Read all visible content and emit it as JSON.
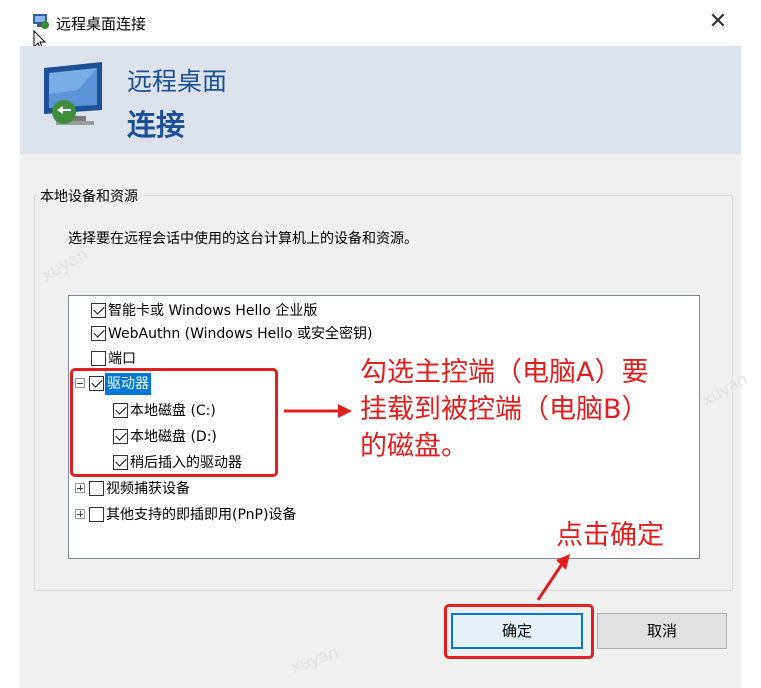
{
  "window": {
    "title": "远程桌面连接",
    "close_glyph": "✕"
  },
  "banner": {
    "line1": "远程桌面",
    "line2": "连接"
  },
  "group": {
    "label": "本地设备和资源",
    "description": "选择要在远程会话中使用的这台计算机上的设备和资源。"
  },
  "tree": {
    "items": [
      {
        "label": "智能卡或 Windows Hello 企业版",
        "checked": true
      },
      {
        "label": "WebAuthn (Windows Hello 或安全密钥)",
        "checked": true
      },
      {
        "label": "端口",
        "checked": false
      },
      {
        "label": "驱动器",
        "checked": true,
        "expanded": true,
        "selected": true
      },
      {
        "label": "本地磁盘 (C:)",
        "checked": true
      },
      {
        "label": "本地磁盘 (D:)",
        "checked": true
      },
      {
        "label": "稍后插入的驱动器",
        "checked": true
      },
      {
        "label": "视频捕获设备",
        "checked": false,
        "expanded": false
      },
      {
        "label": "其他支持的即插即用(PnP)设备",
        "checked": false,
        "expanded": false
      }
    ]
  },
  "annotations": {
    "drives_line1": "勾选主控端（电脑A）要",
    "drives_line2": "挂载到被控端（电脑B）",
    "drives_line3": "的磁盘。",
    "ok_note": "点击确定",
    "color": "#e02020"
  },
  "buttons": {
    "ok": "确定",
    "cancel": "取消"
  },
  "colors": {
    "banner_bg": "#dde3ec",
    "banner_text": "#1c4f95",
    "selection": "#0078d7",
    "dialog_bg": "#f0f0f0"
  },
  "watermarks": {
    "text1": "xuyan",
    "text2": "xuyan",
    "text3": "xuyan"
  }
}
